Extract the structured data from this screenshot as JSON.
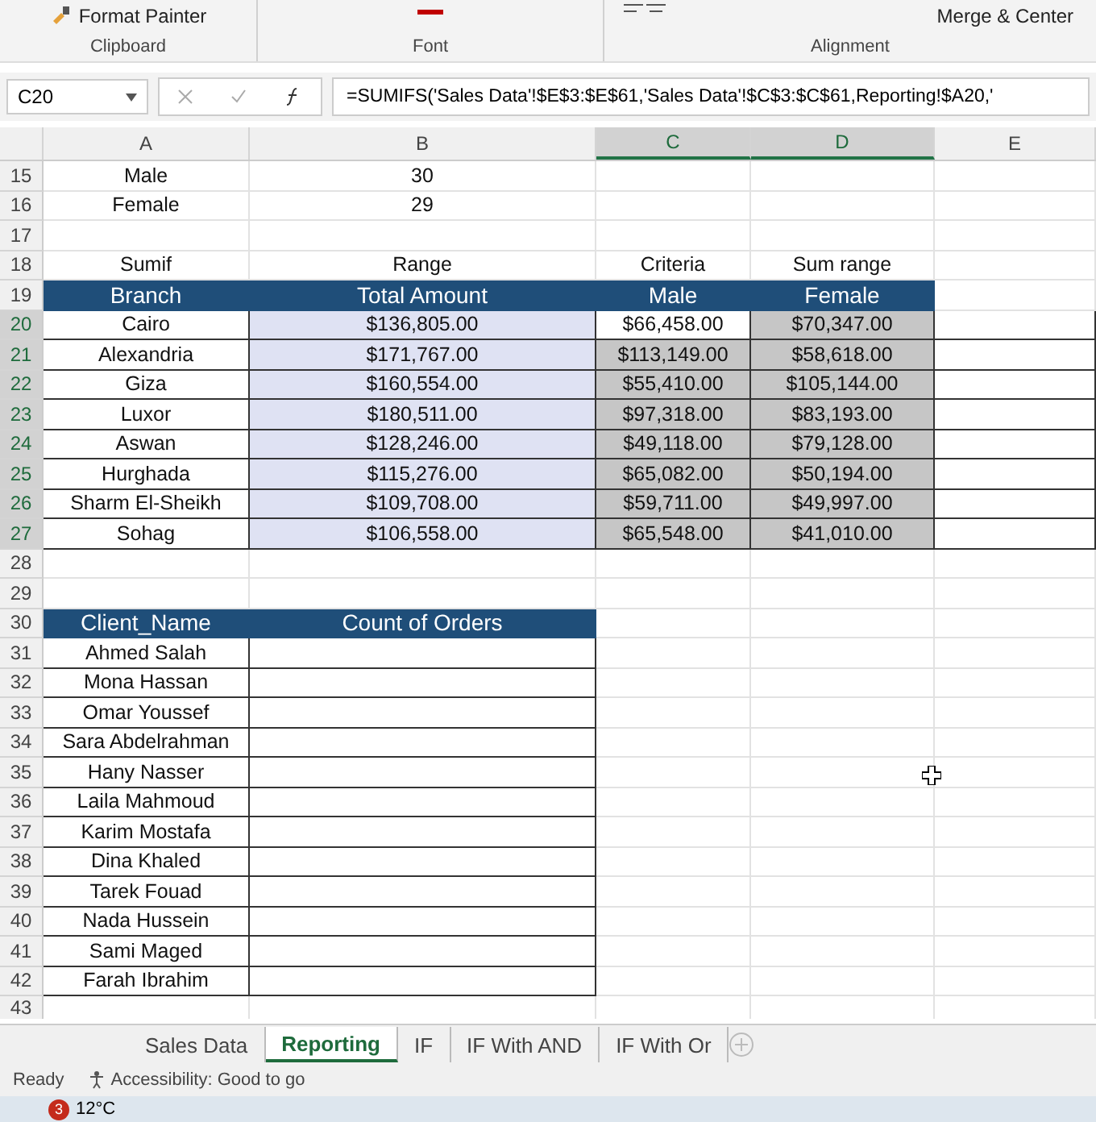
{
  "ribbon": {
    "buttons": [
      {
        "label": "Format Painter"
      },
      {
        "label": "Merge & Center"
      }
    ],
    "groups": [
      "Clipboard",
      "Font",
      "Alignment"
    ]
  },
  "formula_bar": {
    "name_box": "C20",
    "formula": "=SUMIFS('Sales Data'!$E$3:$E$61,'Sales Data'!$C$3:$C$61,Reporting!$A20,'"
  },
  "columns": [
    {
      "label": "A",
      "selected": false
    },
    {
      "label": "B",
      "selected": false
    },
    {
      "label": "C",
      "selected": true
    },
    {
      "label": "D",
      "selected": true
    },
    {
      "label": "E",
      "selected": false
    }
  ],
  "rows": [
    {
      "number": "15",
      "kind": "plain",
      "selected": false,
      "cells": [
        {
          "text": "Male"
        },
        {
          "text": "30"
        }
      ]
    },
    {
      "number": "16",
      "kind": "plain",
      "selected": false,
      "cells": [
        {
          "text": "Female"
        },
        {
          "text": "29"
        }
      ]
    },
    {
      "number": "17",
      "kind": "plain",
      "selected": false,
      "cells": []
    },
    {
      "number": "18",
      "kind": "plain",
      "selected": false,
      "cells": [
        {
          "text": "Sumif"
        },
        {
          "text": "Range"
        },
        {
          "text": "Criteria"
        },
        {
          "text": "Sum range"
        }
      ]
    },
    {
      "number": "19",
      "kind": "header",
      "selected": false,
      "cells": [
        {
          "text": "Branch"
        },
        {
          "text": "Total Amount"
        },
        {
          "text": "Male"
        },
        {
          "text": "Female"
        }
      ]
    },
    {
      "number": "20",
      "kind": "data",
      "selected": true,
      "cells": [
        {
          "text": "Cairo"
        },
        {
          "text": "$136,805.00"
        },
        {
          "text": "$66,458.00",
          "selected": false
        },
        {
          "text": "$70,347.00",
          "selected": true
        }
      ]
    },
    {
      "number": "21",
      "kind": "data",
      "selected": true,
      "cells": [
        {
          "text": "Alexandria"
        },
        {
          "text": "$171,767.00"
        },
        {
          "text": "$113,149.00",
          "selected": true
        },
        {
          "text": "$58,618.00",
          "selected": true
        }
      ]
    },
    {
      "number": "22",
      "kind": "data",
      "selected": true,
      "cells": [
        {
          "text": "Giza"
        },
        {
          "text": "$160,554.00"
        },
        {
          "text": "$55,410.00",
          "selected": true
        },
        {
          "text": "$105,144.00",
          "selected": true
        }
      ]
    },
    {
      "number": "23",
      "kind": "data",
      "selected": true,
      "cells": [
        {
          "text": "Luxor"
        },
        {
          "text": "$180,511.00"
        },
        {
          "text": "$97,318.00",
          "selected": true
        },
        {
          "text": "$83,193.00",
          "selected": true
        }
      ]
    },
    {
      "number": "24",
      "kind": "data",
      "selected": true,
      "cells": [
        {
          "text": "Aswan"
        },
        {
          "text": "$128,246.00"
        },
        {
          "text": "$49,118.00",
          "selected": true
        },
        {
          "text": "$79,128.00",
          "selected": true
        }
      ]
    },
    {
      "number": "25",
      "kind": "data",
      "selected": true,
      "cells": [
        {
          "text": "Hurghada"
        },
        {
          "text": "$115,276.00"
        },
        {
          "text": "$65,082.00",
          "selected": true
        },
        {
          "text": "$50,194.00",
          "selected": true
        }
      ]
    },
    {
      "number": "26",
      "kind": "data",
      "selected": true,
      "cells": [
        {
          "text": "Sharm El-Sheikh"
        },
        {
          "text": "$109,708.00"
        },
        {
          "text": "$59,711.00",
          "selected": true
        },
        {
          "text": "$49,997.00",
          "selected": true
        }
      ]
    },
    {
      "number": "27",
      "kind": "data",
      "selected": true,
      "cells": [
        {
          "text": "Sohag"
        },
        {
          "text": "$106,558.00"
        },
        {
          "text": "$65,548.00",
          "selected": true
        },
        {
          "text": "$41,010.00",
          "selected": true
        }
      ]
    },
    {
      "number": "28",
      "kind": "plain",
      "selected": false,
      "cells": []
    },
    {
      "number": "29",
      "kind": "plain",
      "selected": false,
      "cells": []
    },
    {
      "number": "30",
      "kind": "header",
      "selected": false,
      "cells": [
        {
          "text": "Client_Name"
        },
        {
          "text": "Count of Orders"
        }
      ]
    },
    {
      "number": "31",
      "kind": "client",
      "selected": false,
      "cells": [
        {
          "text": "Ahmed Salah"
        }
      ]
    },
    {
      "number": "32",
      "kind": "client",
      "selected": false,
      "cells": [
        {
          "text": "Mona Hassan"
        }
      ]
    },
    {
      "number": "33",
      "kind": "client",
      "selected": false,
      "cells": [
        {
          "text": "Omar Youssef"
        }
      ]
    },
    {
      "number": "34",
      "kind": "client",
      "selected": false,
      "cells": [
        {
          "text": "Sara Abdelrahman"
        }
      ]
    },
    {
      "number": "35",
      "kind": "client",
      "selected": false,
      "cells": [
        {
          "text": "Hany Nasser"
        }
      ]
    },
    {
      "number": "36",
      "kind": "client",
      "selected": false,
      "cells": [
        {
          "text": "Laila Mahmoud"
        }
      ]
    },
    {
      "number": "37",
      "kind": "client",
      "selected": false,
      "cells": [
        {
          "text": "Karim Mostafa"
        }
      ]
    },
    {
      "number": "38",
      "kind": "client",
      "selected": false,
      "cells": [
        {
          "text": "Dina Khaled"
        }
      ]
    },
    {
      "number": "39",
      "kind": "client",
      "selected": false,
      "cells": [
        {
          "text": "Tarek Fouad"
        }
      ]
    },
    {
      "number": "40",
      "kind": "client",
      "selected": false,
      "cells": [
        {
          "text": "Nada Hussein"
        }
      ]
    },
    {
      "number": "41",
      "kind": "client",
      "selected": false,
      "cells": [
        {
          "text": "Sami Maged"
        }
      ]
    },
    {
      "number": "42",
      "kind": "client",
      "selected": false,
      "cells": [
        {
          "text": "Farah Ibrahim"
        }
      ]
    },
    {
      "number": "43",
      "kind": "partial",
      "selected": false,
      "cells": []
    }
  ],
  "sheet_tabs": [
    {
      "label": "Sales Data",
      "selected": false
    },
    {
      "label": "Reporting",
      "selected": true
    },
    {
      "label": "IF",
      "selected": false
    },
    {
      "label": "IF With AND",
      "selected": false
    },
    {
      "label": "IF With Or",
      "selected": false
    }
  ],
  "status_bar": {
    "mode": "Ready",
    "accessibility": "Accessibility: Good to go"
  },
  "taskbar": {
    "badge": "3",
    "weather": "12°C"
  }
}
